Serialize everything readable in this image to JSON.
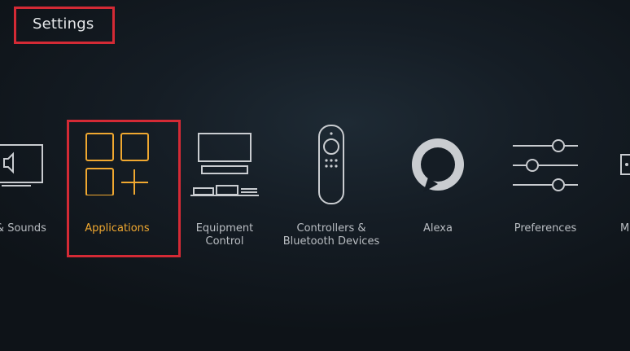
{
  "header": {
    "title": "Settings"
  },
  "tiles": [
    {
      "id": "display-sounds",
      "label_lines": [
        "y & Sounds"
      ],
      "icon": "tv-speaker-icon",
      "focused": false
    },
    {
      "id": "applications",
      "label_lines": [
        "Applications"
      ],
      "icon": "apps-grid-plus-icon",
      "focused": true
    },
    {
      "id": "equipment-control",
      "label_lines": [
        "Equipment",
        "Control"
      ],
      "icon": "tv-soundbar-icon",
      "focused": false
    },
    {
      "id": "controllers-bluetooth",
      "label_lines": [
        "Controllers &",
        "Bluetooth Devices"
      ],
      "icon": "remote-control-icon",
      "focused": false
    },
    {
      "id": "alexa",
      "label_lines": [
        "Alexa"
      ],
      "icon": "alexa-ring-icon",
      "focused": false
    },
    {
      "id": "preferences",
      "label_lines": [
        "Preferences"
      ],
      "icon": "sliders-icon",
      "focused": false
    },
    {
      "id": "my-fire-tv",
      "label_lines": [
        "M"
      ],
      "icon": "device-icon",
      "focused": false
    }
  ],
  "colors": {
    "accent": "#f0a830",
    "highlight": "#d42a35",
    "icon": "#c9ccd0"
  }
}
